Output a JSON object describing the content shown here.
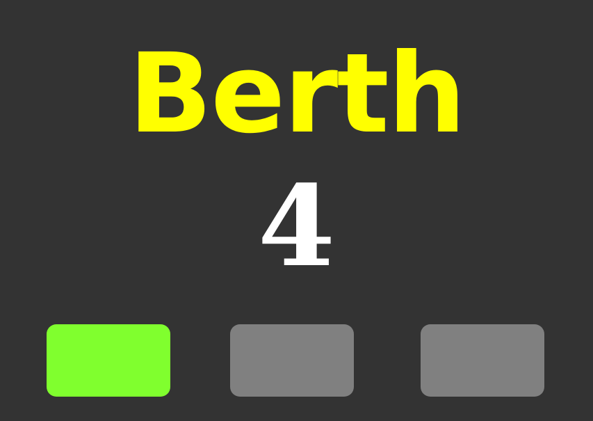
{
  "berth": {
    "label": "Berth",
    "number": "4"
  },
  "colors": {
    "background": "#333333",
    "label": "#ffff00",
    "number": "#ffffff",
    "indicator_active": "#80ff2e",
    "indicator_inactive": "#808080"
  },
  "indicators": [
    {
      "name": "indicator-1",
      "active": true
    },
    {
      "name": "indicator-2",
      "active": false
    },
    {
      "name": "indicator-3",
      "active": false
    }
  ]
}
